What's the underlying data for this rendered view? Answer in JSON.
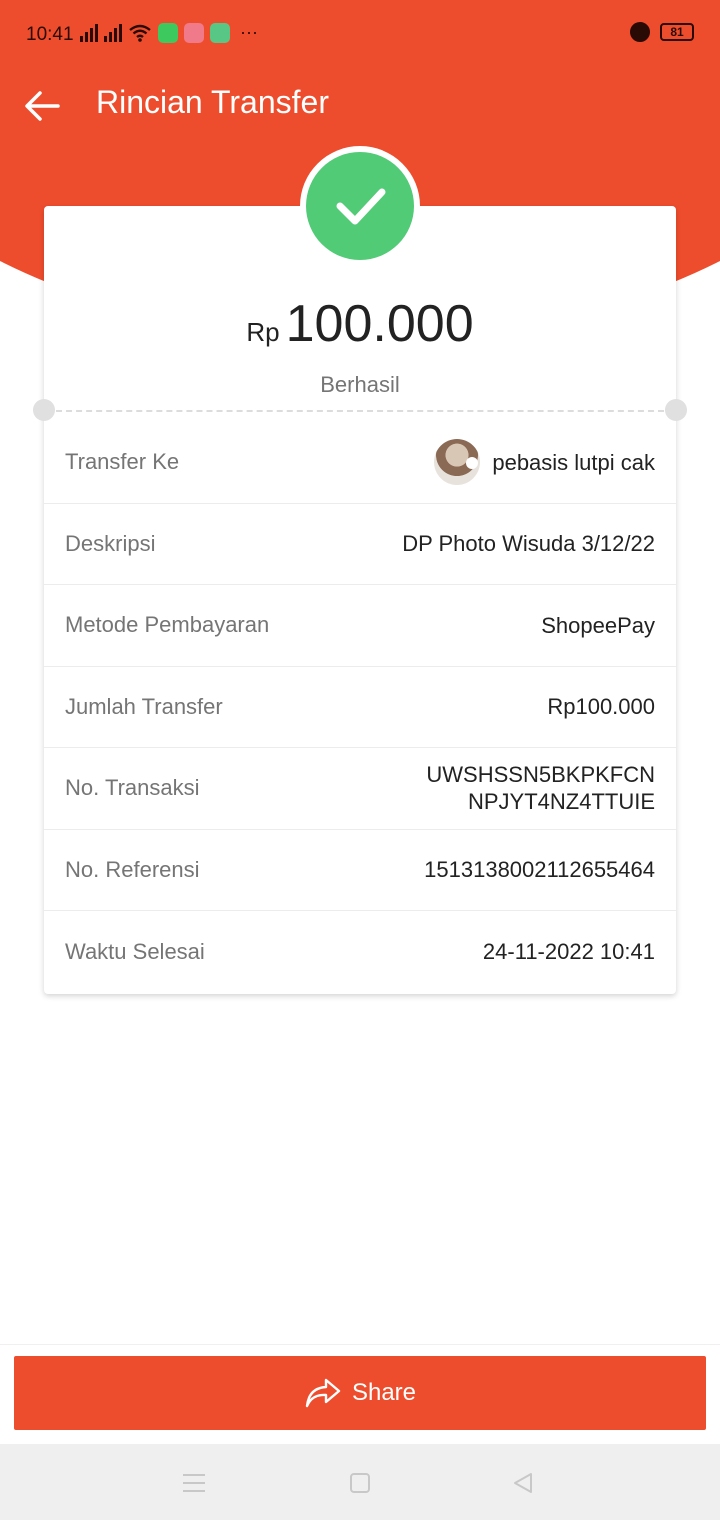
{
  "status_bar": {
    "time": "10:41",
    "battery": "81",
    "more": "···"
  },
  "header": {
    "title": "Rincian Transfer",
    "back_icon": "arrow-left-icon"
  },
  "summary": {
    "currency": "Rp",
    "amount": "100.000",
    "status": "Berhasil",
    "status_icon": "check-icon"
  },
  "details": {
    "transfer_to": {
      "label": "Transfer Ke",
      "value": "pebasis lutpi cak"
    },
    "description": {
      "label": "Deskripsi",
      "value": "DP Photo Wisuda 3/12/22"
    },
    "payment_method": {
      "label": "Metode Pembayaran",
      "value": "ShopeePay"
    },
    "amount": {
      "label": "Jumlah Transfer",
      "value": "Rp100.000"
    },
    "transaction_no": {
      "label": "No. Transaksi",
      "value_line1": "UWSHSSN5BKPKFCN",
      "value_line2": "NPJYT4NZ4TTUIE"
    },
    "reference_no": {
      "label": "No. Referensi",
      "value": "151313800211265 5464"
    },
    "completed_time": {
      "label": "Waktu Selesai",
      "value": "24-11-2022 10:41"
    }
  },
  "actions": {
    "share_label": "Share",
    "share_icon": "share-arrow-icon"
  },
  "colors": {
    "brand": "#ee4d2d",
    "success": "#51cb76"
  }
}
